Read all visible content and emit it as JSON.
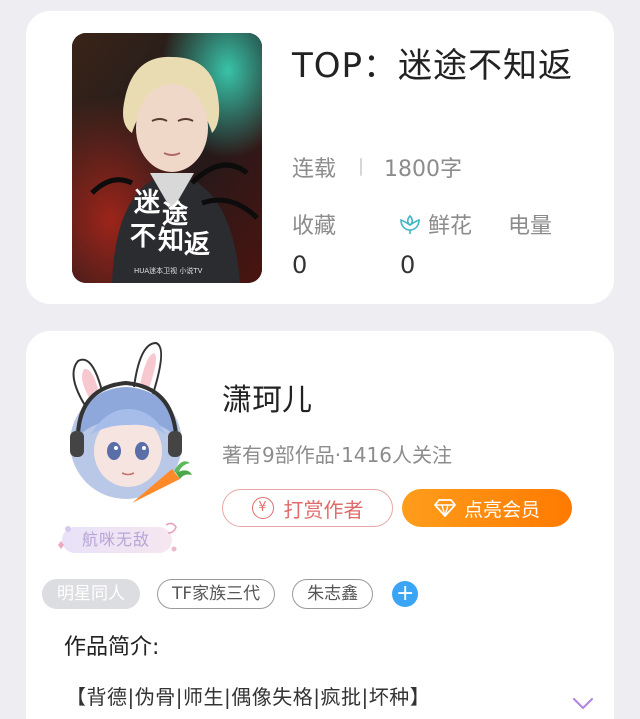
{
  "book": {
    "title": "TOP：迷途不知返",
    "status": "连载",
    "word_count": "1800字",
    "stats": [
      {
        "label": "收藏",
        "value": "0"
      },
      {
        "label": "鲜花",
        "value": "0",
        "icon": "flower-icon"
      },
      {
        "label": "电量"
      }
    ],
    "cover": {
      "title_chars": [
        "迷",
        "途",
        "不",
        "知",
        "返"
      ],
      "footer_text": "HUA迷本卫视  小说TV"
    }
  },
  "author": {
    "name": "潇珂儿",
    "stats_text": "著有9部作品·1416人关注",
    "badge": "航咪无敌",
    "reward_label": "打赏作者",
    "reward_icon_glyph": "¥",
    "vip_label": "点亮会员"
  },
  "tags": [
    "明星同人",
    "TF家族三代",
    "朱志鑫"
  ],
  "add_tag_glyph": "+",
  "intro": {
    "heading": "作品简介:",
    "text": "【背德|伪骨|师生|偶像失格|疯批|坏种】"
  },
  "colors": {
    "accent_orange": "#ff8a00",
    "reward_red": "#e06b6b",
    "tag_blue": "#3aa5f5",
    "flower_teal": "#3db6c8"
  }
}
